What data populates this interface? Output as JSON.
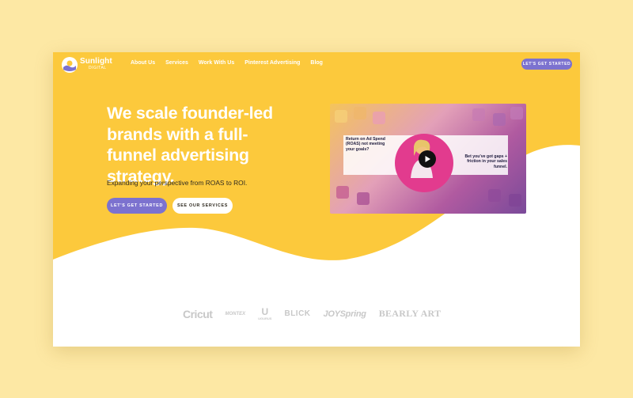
{
  "brand": {
    "name": "Sunlight",
    "tagline": "DIGITAL"
  },
  "nav": {
    "links": [
      "About Us",
      "Services",
      "Work With Us",
      "Pinterest Advertising",
      "Blog"
    ],
    "cta": "LET'S GET STARTED"
  },
  "hero": {
    "headline": "We scale founder-led brands with a full-funnel advertising strategy.",
    "subheadline": "Expanding your perspective from ROAS to ROI.",
    "primary_button": "LET'S GET STARTED",
    "secondary_button": "SEE OUR SERVICES"
  },
  "video": {
    "left_text": "Return on Ad Spend (ROAS) not meeting your goals?",
    "right_text": "Bet you've got gaps + friction in your sales funnel."
  },
  "client_logos": [
    "Cricut",
    "MONTEX",
    "UGURUS",
    "BLICK",
    "JOYSpring",
    "BEARLY ART"
  ],
  "colors": {
    "page_bg": "#fde8a4",
    "hero_yellow": "#fcc93c",
    "accent_purple": "#7c72cf",
    "logo_grey": "#c8c8c8"
  }
}
